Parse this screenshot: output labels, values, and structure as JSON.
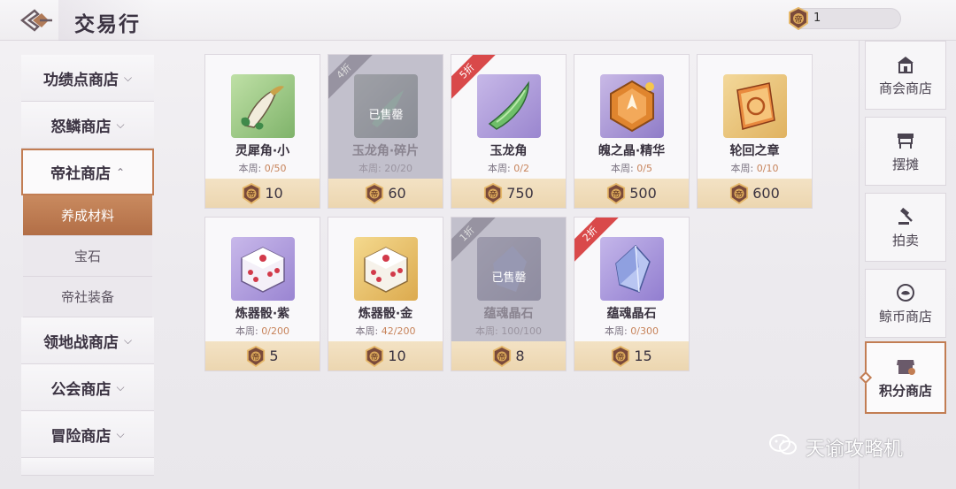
{
  "header": {
    "title": "交易行",
    "currency_amount": "1"
  },
  "sidebar": {
    "items": [
      {
        "label": "功绩点商店",
        "chevron": "⌵"
      },
      {
        "label": "怒鳞商店",
        "chevron": "⌵"
      },
      {
        "label": "帝社商店",
        "chevron": "⌃"
      },
      {
        "label": "领地战商店",
        "chevron": "⌵"
      },
      {
        "label": "公会商店",
        "chevron": "⌵"
      },
      {
        "label": "冒险商店",
        "chevron": "⌵"
      }
    ],
    "subitems": [
      {
        "label": "养成材料"
      },
      {
        "label": "宝石"
      },
      {
        "label": "帝社装备"
      }
    ],
    "coin_glyph": "帝"
  },
  "items": [
    {
      "name": "灵犀角·小",
      "limit_label": "本周:",
      "limit": "0/50",
      "price": "10",
      "sold": false,
      "discount": ""
    },
    {
      "name": "玉龙角·碎片",
      "limit_label": "本周:",
      "limit": "20/20",
      "price": "60",
      "sold": true,
      "sold_label": "已售罄",
      "discount": "4折"
    },
    {
      "name": "玉龙角",
      "limit_label": "本周:",
      "limit": "0/2",
      "price": "750",
      "sold": false,
      "discount": "5折"
    },
    {
      "name": "魄之晶·精华",
      "limit_label": "本周:",
      "limit": "0/5",
      "price": "500",
      "sold": false,
      "discount": ""
    },
    {
      "name": "轮回之章",
      "limit_label": "本周:",
      "limit": "0/10",
      "price": "600",
      "sold": false,
      "discount": ""
    },
    {
      "name": "炼器骰·紫",
      "limit_label": "本周:",
      "limit": "0/200",
      "price": "5",
      "sold": false,
      "discount": ""
    },
    {
      "name": "炼器骰·金",
      "limit_label": "本周:",
      "limit": "42/200",
      "price": "10",
      "sold": false,
      "discount": ""
    },
    {
      "name": "蕴魂晶石",
      "limit_label": "本周:",
      "limit": "100/100",
      "price": "8",
      "sold": true,
      "sold_label": "已售罄",
      "discount": "1折"
    },
    {
      "name": "蕴魂晶石",
      "limit_label": "本周:",
      "limit": "0/300",
      "price": "15",
      "sold": false,
      "discount": "2折"
    }
  ],
  "rightnav": {
    "items": [
      {
        "label": "商会商店"
      },
      {
        "label": "摆摊"
      },
      {
        "label": "拍卖"
      },
      {
        "label": "鲸币商店"
      },
      {
        "label": "积分商店"
      }
    ]
  },
  "watermark": {
    "text": "天谕攻略机"
  },
  "colors": {
    "accent": "#c27d53",
    "discount_red": "#d9494a",
    "price_bar": "#f0ddb9"
  }
}
